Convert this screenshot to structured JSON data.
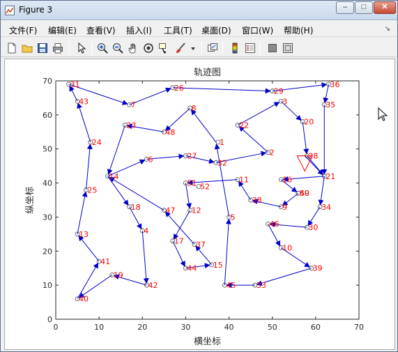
{
  "window": {
    "title": "Figure 3",
    "min_label": "–",
    "max_label": "□",
    "close_label": "✕"
  },
  "menu": [
    "文件(F)",
    "编辑(E)",
    "查看(V)",
    "插入(I)",
    "工具(T)",
    "桌面(D)",
    "窗口(W)",
    "帮助(H)"
  ],
  "toolbar_icons": [
    "new-figure-icon",
    "open-file-icon",
    "save-icon",
    "print-icon",
    "pointer-icon",
    "zoom-in-icon",
    "zoom-out-icon",
    "pan-icon",
    "rotate-3d-icon",
    "data-cursor-icon",
    "brush-icon",
    "brush-dropdown-icon",
    "link-plot-icon",
    "colorbar-icon",
    "legend-icon",
    "hide-plot-tools-icon",
    "show-plot-tools-icon"
  ],
  "chart_data": {
    "type": "line",
    "title": "轨迹图",
    "xlabel": "横坐标",
    "ylabel": "纵坐标",
    "xlim": [
      0,
      70
    ],
    "ylim": [
      0,
      70
    ],
    "xticks": [
      0,
      10,
      20,
      30,
      40,
      50,
      60,
      70
    ],
    "yticks": [
      0,
      10,
      20,
      30,
      40,
      50,
      60,
      70
    ],
    "grid": false,
    "colors": {
      "path": "#0000cc",
      "labels": "#ff0000",
      "markers": "#333333",
      "start_marker": "#ff0000"
    },
    "start_marker": {
      "x": 57.5,
      "y": 48,
      "shape": "triangle-down"
    },
    "points": [
      {
        "id": "1",
        "x": 37.5,
        "y": 52
      },
      {
        "id": "2",
        "x": 49,
        "y": 49
      },
      {
        "id": "3",
        "x": 52,
        "y": 64
      },
      {
        "id": "4",
        "x": 20,
        "y": 26
      },
      {
        "id": "5",
        "x": 40,
        "y": 30
      },
      {
        "id": "6",
        "x": 21,
        "y": 47
      },
      {
        "id": "7",
        "x": 17,
        "y": 63
      },
      {
        "id": "8",
        "x": 31,
        "y": 62
      },
      {
        "id": "9",
        "x": 52,
        "y": 33
      },
      {
        "id": "10",
        "x": 52,
        "y": 21
      },
      {
        "id": "11",
        "x": 42,
        "y": 41
      },
      {
        "id": "12",
        "x": 31,
        "y": 32
      },
      {
        "id": "13",
        "x": 5,
        "y": 25
      },
      {
        "id": "14",
        "x": 12,
        "y": 42
      },
      {
        "id": "15",
        "x": 36,
        "y": 16
      },
      {
        "id": "16",
        "x": 52,
        "y": 41
      },
      {
        "id": "17",
        "x": 27,
        "y": 23
      },
      {
        "id": "18",
        "x": 17,
        "y": 33
      },
      {
        "id": "19",
        "x": 13,
        "y": 13
      },
      {
        "id": "20",
        "x": 57,
        "y": 58
      },
      {
        "id": "21",
        "x": 62,
        "y": 42
      },
      {
        "id": "22",
        "x": 42,
        "y": 57
      },
      {
        "id": "23",
        "x": 16,
        "y": 57
      },
      {
        "id": "24",
        "x": 8,
        "y": 52
      },
      {
        "id": "25",
        "x": 7,
        "y": 38
      },
      {
        "id": "26",
        "x": 27,
        "y": 68
      },
      {
        "id": "27",
        "x": 30,
        "y": 48
      },
      {
        "id": "28",
        "x": 58,
        "y": 48
      },
      {
        "id": "29",
        "x": 50,
        "y": 67
      },
      {
        "id": "30",
        "x": 58,
        "y": 27
      },
      {
        "id": "31",
        "x": 3,
        "y": 69
      },
      {
        "id": "32",
        "x": 37,
        "y": 46
      },
      {
        "id": "33",
        "x": 46,
        "y": 10
      },
      {
        "id": "34",
        "x": 61,
        "y": 33
      },
      {
        "id": "35",
        "x": 62,
        "y": 63
      },
      {
        "id": "36",
        "x": 63,
        "y": 69
      },
      {
        "id": "37",
        "x": 32,
        "y": 22
      },
      {
        "id": "38",
        "x": 45,
        "y": 35
      },
      {
        "id": "39",
        "x": 59,
        "y": 15
      },
      {
        "id": "40",
        "x": 5,
        "y": 6
      },
      {
        "id": "41",
        "x": 10,
        "y": 17
      },
      {
        "id": "42",
        "x": 21,
        "y": 10
      },
      {
        "id": "43",
        "x": 5,
        "y": 64
      },
      {
        "id": "44",
        "x": 30,
        "y": 15
      },
      {
        "id": "45",
        "x": 39,
        "y": 10
      },
      {
        "id": "46",
        "x": 49,
        "y": 28
      },
      {
        "id": "47",
        "x": 25,
        "y": 32
      },
      {
        "id": "48",
        "x": 25,
        "y": 55
      },
      {
        "id": "49",
        "x": 56,
        "y": 37
      },
      {
        "id": "50",
        "x": 56,
        "y": 37
      },
      {
        "id": "51",
        "x": 30,
        "y": 40
      },
      {
        "id": "52",
        "x": 33,
        "y": 39
      }
    ],
    "path": [
      {
        "x": 57.5,
        "y": 48
      },
      {
        "x": 62,
        "y": 42
      },
      {
        "x": 52,
        "y": 41
      },
      {
        "x": 56,
        "y": 37
      },
      {
        "x": 52,
        "y": 33
      },
      {
        "x": 45,
        "y": 35
      },
      {
        "x": 42,
        "y": 41
      },
      {
        "x": 30,
        "y": 40
      },
      {
        "x": 31,
        "y": 32
      },
      {
        "x": 27,
        "y": 23
      },
      {
        "x": 30,
        "y": 15
      },
      {
        "x": 36,
        "y": 16
      },
      {
        "x": 32,
        "y": 22
      },
      {
        "x": 25,
        "y": 32
      },
      {
        "x": 12,
        "y": 42
      },
      {
        "x": 21,
        "y": 47
      },
      {
        "x": 30,
        "y": 48
      },
      {
        "x": 37,
        "y": 46
      },
      {
        "x": 49,
        "y": 49
      },
      {
        "x": 42,
        "y": 57
      },
      {
        "x": 52,
        "y": 64
      },
      {
        "x": 57,
        "y": 58
      },
      {
        "x": 58,
        "y": 48
      },
      {
        "x": 62,
        "y": 42
      },
      {
        "x": 61,
        "y": 33
      },
      {
        "x": 58,
        "y": 27
      },
      {
        "x": 49,
        "y": 28
      },
      {
        "x": 52,
        "y": 21
      },
      {
        "x": 59,
        "y": 15
      },
      {
        "x": 46,
        "y": 10
      },
      {
        "x": 39,
        "y": 10
      },
      {
        "x": 40,
        "y": 30
      },
      {
        "x": 37,
        "y": 52
      },
      {
        "x": 31,
        "y": 62
      },
      {
        "x": 25,
        "y": 55
      },
      {
        "x": 16,
        "y": 57
      },
      {
        "x": 12,
        "y": 42
      },
      {
        "x": 17,
        "y": 33
      },
      {
        "x": 20,
        "y": 26
      },
      {
        "x": 21,
        "y": 10
      },
      {
        "x": 13,
        "y": 13
      },
      {
        "x": 5,
        "y": 6
      },
      {
        "x": 10,
        "y": 17
      },
      {
        "x": 5,
        "y": 25
      },
      {
        "x": 7,
        "y": 38
      },
      {
        "x": 8,
        "y": 52
      },
      {
        "x": 5,
        "y": 64
      },
      {
        "x": 3,
        "y": 69
      },
      {
        "x": 17,
        "y": 63
      },
      {
        "x": 27,
        "y": 68
      },
      {
        "x": 50,
        "y": 67
      },
      {
        "x": 63,
        "y": 69
      },
      {
        "x": 62,
        "y": 63
      },
      {
        "x": 62,
        "y": 42
      }
    ]
  }
}
